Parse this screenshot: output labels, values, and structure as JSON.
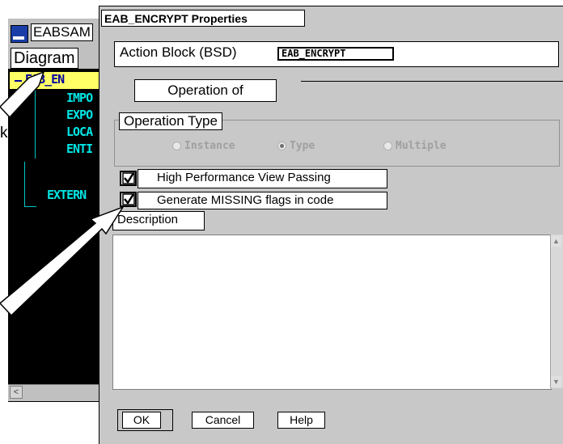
{
  "background_window": {
    "title": "EABSAM",
    "menu_item": "Diagram",
    "stray_label": "k",
    "tree": {
      "root": "EAB_EN",
      "children": [
        "IMPO",
        "EXPO",
        "LOCA",
        "ENTI"
      ],
      "external": "EXTERN"
    },
    "scroll_left_glyph": "<"
  },
  "dialog": {
    "title": "EAB_ENCRYPT Properties",
    "action_block_label": "Action Block (BSD)",
    "action_block_value": "EAB_ENCRYPT",
    "operation_of_label": "Operation of",
    "operation_type_legend": "Operation Type",
    "radios": [
      {
        "label": "Instance",
        "selected": false
      },
      {
        "label": "Type",
        "selected": true
      },
      {
        "label": "Multiple",
        "selected": false
      }
    ],
    "checkboxes": [
      {
        "label": "High Performance View Passing",
        "checked": true
      },
      {
        "label": "Generate MISSING flags in code",
        "checked": true
      }
    ],
    "description_label": "Description",
    "description_value": "",
    "buttons": {
      "ok": "OK",
      "cancel": "Cancel",
      "help": "Help"
    }
  },
  "colors": {
    "dialog_bg": "#c8c8c8",
    "tree_bg": "#000000",
    "tree_text": "#00e5e5",
    "tree_highlight": "#ffff66"
  },
  "icons": [
    "app-icon",
    "checkbox-checked-icon",
    "radio-icon",
    "scroll-up-icon",
    "scroll-down-icon",
    "callout-arrow-icon"
  ]
}
